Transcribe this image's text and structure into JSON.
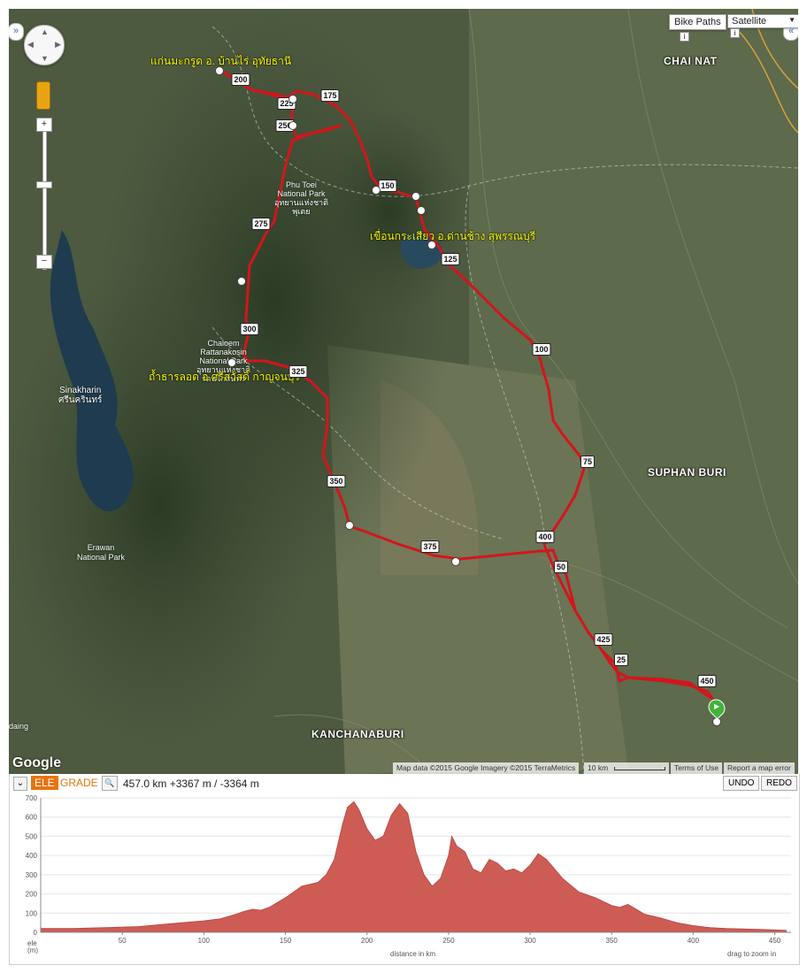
{
  "map": {
    "controls": {
      "bike_paths": "Bike Paths",
      "satellite": "Satellite",
      "zoom_in": "+",
      "zoom_out": "−",
      "collapse_left": "»",
      "collapse_right": "«"
    },
    "cities": {
      "chai_nat": "CHAI NAT",
      "suphan_buri": "SUPHAN BURI",
      "kanchanaburi": "KANCHANABURI",
      "daing": "daing"
    },
    "parks": {
      "phu_toei": [
        "Phu Toei",
        "National Park",
        "อุทยานแห่งชาติ",
        "พุเตย"
      ],
      "chaloem": [
        "Chaloem",
        "Rattanakosin",
        "National Park",
        "อุทยานแห่งชาติ",
        "รัตนโกสินทร์"
      ],
      "sinakharin": [
        "Sinakharin",
        "ศรีนครินทร์"
      ],
      "erawan": [
        "Erawan",
        "National Park"
      ]
    },
    "annotations": {
      "kaeng_makrut": "แก่นมะกรูด อ. บ้านไร่ อุทัยธานี",
      "kra_siao": "เขื่อนกระเสียว อ.ด่านช้าง สุพรรณบุรี",
      "tham_than_lot": "ถ้ำธารลอด อ.ศรีสวัสดิ์  กาญจนบุรี"
    },
    "km_markers": [
      "200",
      "225",
      "250",
      "175",
      "150",
      "275",
      "125",
      "300",
      "325",
      "100",
      "75",
      "350",
      "400",
      "375",
      "50",
      "425",
      "25",
      "450"
    ],
    "attribution": {
      "data": "Map data ©2015 Google Imagery ©2015 TerraMetrics",
      "scale": "10 km",
      "terms": "Terms of Use",
      "report": "Report a map error"
    },
    "logo": "Google",
    "route_color": "#d4151b"
  },
  "profile": {
    "toolbar": {
      "collapse": "⌄",
      "ele_tab": "ELE",
      "grade_tab": "GRADE",
      "zoom_icon": "🔍",
      "summary": "457.0 km +3367 m / -3364 m",
      "undo": "UNDO",
      "redo": "REDO"
    },
    "axis": {
      "ylabel_top": "ele",
      "ylabel_unit": "(m)",
      "xlabel": "distance in km",
      "hint": "drag to zoom in"
    },
    "fill_color": "#cd5c55"
  },
  "chart_data": {
    "type": "area",
    "xlabel": "distance in km",
    "ylabel": "ele (m)",
    "xlim": [
      0,
      460
    ],
    "ylim": [
      0,
      700
    ],
    "x_ticks": [
      50,
      100,
      150,
      200,
      250,
      300,
      350,
      400,
      450
    ],
    "y_ticks": [
      0,
      100,
      200,
      300,
      400,
      500,
      600,
      700
    ],
    "series": [
      {
        "x": [
          0,
          20,
          40,
          60,
          80,
          100,
          110,
          120,
          125,
          130,
          135,
          140,
          150,
          160,
          170,
          175,
          180,
          185,
          188,
          192,
          195,
          200,
          205,
          210,
          215,
          220,
          225,
          230,
          235,
          240,
          245,
          250,
          252,
          255,
          260,
          265,
          270,
          275,
          280,
          285,
          290,
          295,
          300,
          305,
          310,
          315,
          320,
          330,
          340,
          350,
          355,
          360,
          365,
          370,
          380,
          390,
          400,
          410,
          420,
          440,
          457
        ],
        "y": [
          20,
          20,
          25,
          30,
          45,
          60,
          70,
          95,
          110,
          120,
          115,
          130,
          180,
          240,
          260,
          300,
          380,
          560,
          650,
          680,
          640,
          540,
          480,
          500,
          610,
          670,
          620,
          420,
          300,
          240,
          280,
          400,
          500,
          450,
          420,
          330,
          310,
          380,
          360,
          320,
          330,
          310,
          350,
          410,
          380,
          330,
          280,
          210,
          180,
          140,
          130,
          145,
          120,
          95,
          75,
          50,
          35,
          25,
          20,
          15,
          10
        ]
      }
    ]
  }
}
